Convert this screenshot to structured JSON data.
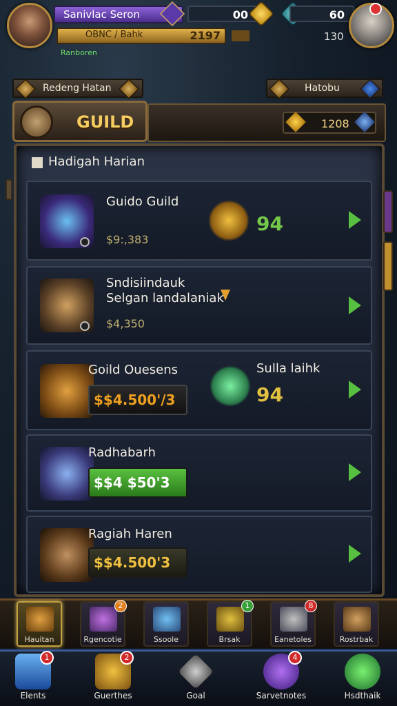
{
  "header": {
    "player_name": "Sanivlac Seron",
    "gold_label": "OBNC / Bahk",
    "gold_value": "2197",
    "rank_text": "Ranboren",
    "resource_1": "00",
    "resource_2": "60",
    "resource_3": "130",
    "sub_left_label": "Redeng Hatan",
    "sub_right_label": "Hatobu"
  },
  "guild": {
    "title": "GUILD",
    "currency_value": "1208",
    "panel_title": "Hadigah Harian"
  },
  "rows": [
    {
      "title": "Guido Guild",
      "price": "$9:,383",
      "score": "94"
    },
    {
      "title": "Sndisiindauk",
      "subtitle": "Selgan landalaniak",
      "price": "$4,350"
    },
    {
      "title": "Goild Ouesens",
      "price_box": "$$4.500'/3",
      "right_title": "Sulla laihk",
      "score": "94"
    },
    {
      "title": "Radhabarh",
      "price_box": "$$4 $50'3"
    },
    {
      "title": "Ragiah Haren",
      "price_box": "$$4.500'3"
    }
  ],
  "tabs": [
    {
      "label": "Hauitan",
      "icon": "chest-icon"
    },
    {
      "label": "Rgencotie",
      "icon": "chest-purple-icon",
      "badge": "2"
    },
    {
      "label": "Ssoole",
      "icon": "chest-blue-icon"
    },
    {
      "label": "Brsak",
      "icon": "chest-gold-icon",
      "badge": "1"
    },
    {
      "label": "Eanetoles",
      "icon": "armor-icon",
      "badge": "8"
    },
    {
      "label": "Rostrbak",
      "icon": "cart-icon"
    }
  ],
  "bottom_nav": [
    {
      "label": "Elents",
      "icon": "home-icon",
      "badge": "1"
    },
    {
      "label": "Guerthes",
      "icon": "quest-icon",
      "badge": "2"
    },
    {
      "label": "Goal",
      "icon": "dice-icon"
    },
    {
      "label": "Sarvetnotes",
      "icon": "cube-icon",
      "badge": "4"
    },
    {
      "label": "Hsdthaik",
      "icon": "face-icon"
    }
  ],
  "colors": {
    "accent_gold": "#f5cc60",
    "accept_green": "#58c040",
    "price_green": "#3aa23a",
    "name_purple": "#8c62d8"
  }
}
